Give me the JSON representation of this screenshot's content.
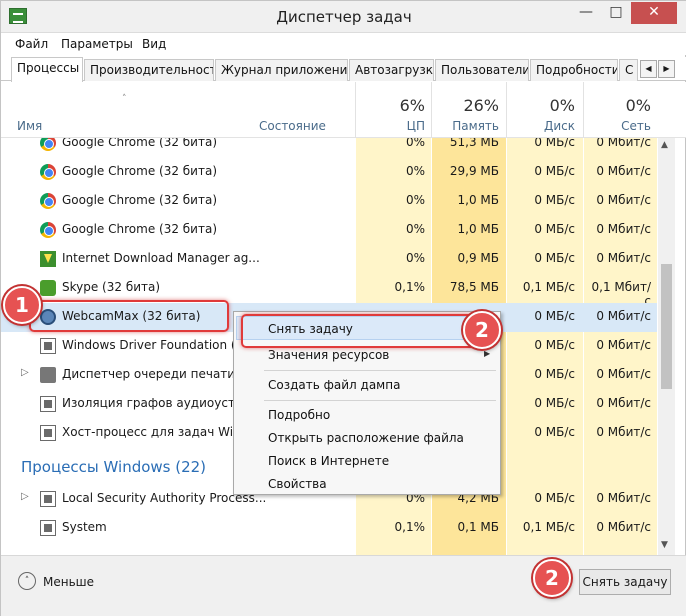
{
  "window": {
    "title": "Диспетчер задач",
    "min_glyph": "—",
    "max_glyph": "□",
    "close_glyph": "✕"
  },
  "menu": [
    "Файл",
    "Параметры",
    "Вид"
  ],
  "tabs": [
    "Процессы",
    "Производительность",
    "Журнал приложений",
    "Автозагрузка",
    "Пользователи",
    "Подробности",
    "С"
  ],
  "tab_scroll": {
    "left": "◀",
    "right": "▶"
  },
  "columns": {
    "name": "Имя",
    "status": "Состояние",
    "cpu": {
      "pct": "6%",
      "label": "ЦП"
    },
    "memory": {
      "pct": "26%",
      "label": "Память"
    },
    "disk": {
      "pct": "0%",
      "label": "Диск"
    },
    "network": {
      "pct": "0%",
      "label": "Сеть"
    }
  },
  "rows": [
    {
      "name": "Google Chrome (32 бита)",
      "cpu": "0%",
      "mem": "51,3 МБ",
      "disk": "0 МБ/с",
      "net": "0 Мбит/с",
      "icon": "chrome-icon"
    },
    {
      "name": "Google Chrome (32 бита)",
      "cpu": "0%",
      "mem": "29,9 МБ",
      "disk": "0 МБ/с",
      "net": "0 Мбит/с",
      "icon": "chrome-icon"
    },
    {
      "name": "Google Chrome (32 бита)",
      "cpu": "0%",
      "mem": "1,0 МБ",
      "disk": "0 МБ/с",
      "net": "0 Мбит/с",
      "icon": "chrome-icon"
    },
    {
      "name": "Google Chrome (32 бита)",
      "cpu": "0%",
      "mem": "1,0 МБ",
      "disk": "0 МБ/с",
      "net": "0 Мбит/с",
      "icon": "chrome-icon"
    },
    {
      "name": "Internet Download Manager ag...",
      "cpu": "0%",
      "mem": "0,9 МБ",
      "disk": "0 МБ/с",
      "net": "0 Мбит/с",
      "icon": "download-manager-icon"
    },
    {
      "name": "Skype (32 бита)",
      "cpu": "0,1%",
      "mem": "78,5 МБ",
      "disk": "0,1 МБ/с",
      "net": "0,1 Мбит/с",
      "icon": "skype-icon"
    },
    {
      "name": "WebcamMax (32 бита)",
      "cpu": "",
      "mem": "",
      "disk": "0 МБ/с",
      "net": "0 Мбит/с",
      "icon": "webcam-icon"
    },
    {
      "name": "Windows Driver Foundation (W",
      "cpu": "",
      "mem": "",
      "disk": "0 МБ/с",
      "net": "0 Мбит/с",
      "icon": "service-icon"
    },
    {
      "name": "Диспетчер очереди печати",
      "cpu": "",
      "mem": "",
      "disk": "0 МБ/с",
      "net": "0 Мбит/с",
      "icon": "printer-icon",
      "expandable": true
    },
    {
      "name": "Изоляция графов аудиоустро",
      "cpu": "",
      "mem": "",
      "disk": "0 МБ/с",
      "net": "0 Мбит/с",
      "icon": "service-icon"
    },
    {
      "name": "Хост-процесс для задач Winde",
      "cpu": "",
      "mem": "",
      "disk": "0 МБ/с",
      "net": "0 Мбит/с",
      "icon": "service-icon"
    }
  ],
  "section": "Процессы Windows (22)",
  "rows2": [
    {
      "name": "Local Security Authority Process...",
      "cpu": "0%",
      "mem": "4,2 МБ",
      "disk": "0 МБ/с",
      "net": "0 Мбит/с",
      "expandable": true
    },
    {
      "name": "System",
      "cpu": "0,1%",
      "mem": "0,1 МБ",
      "disk": "0,1 МБ/с",
      "net": "0 Мбит/с"
    }
  ],
  "context_menu": {
    "end_task": "Снять задачу",
    "resource_values": "Значения ресурсов",
    "dump": "Создать файл дампа",
    "details": "Подробно",
    "open_location": "Открыть расположение файла",
    "search_web": "Поиск в Интернете",
    "properties": "Свойства"
  },
  "badges": {
    "one": "1",
    "two": "2"
  },
  "footer": {
    "less": "Меньше",
    "end_task_button": "Снять задачу",
    "less_glyph": "˄"
  },
  "scroll": {
    "up": "▲",
    "down": "▼"
  },
  "sort_glyph": "˄",
  "submenu_glyph": "▶",
  "expander_glyph": "▷",
  "colors": {
    "cpu_bg": "#fff5c9",
    "mem_bg": "#fde59a",
    "selection": "#d8e8f7",
    "highlight": "#e03a3a",
    "section": "#2a6db5"
  }
}
